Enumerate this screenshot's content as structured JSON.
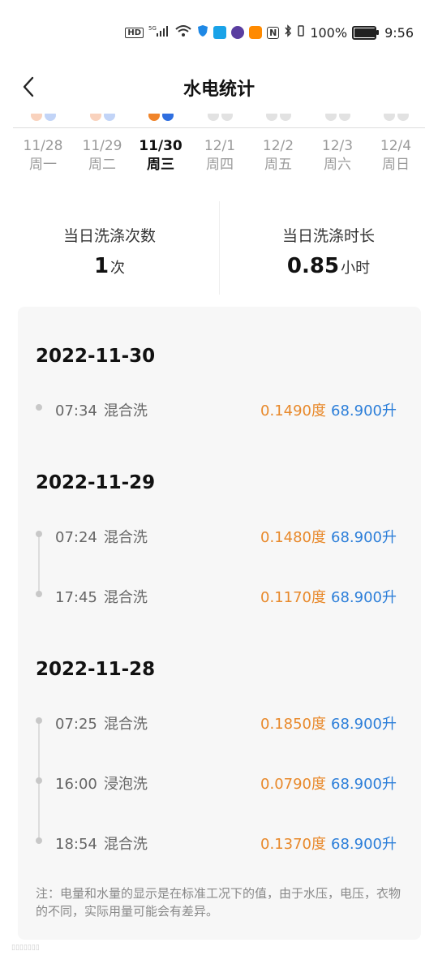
{
  "status_bar": {
    "hd": "HD",
    "net1": "5G",
    "net2": "6",
    "nfc": "N",
    "battery_label": "100%",
    "battery_level": 1.0,
    "time": "9:56"
  },
  "header": {
    "title": "水电统计",
    "back_icon": "chevron-left-icon"
  },
  "week": {
    "days": [
      {
        "date": "11/28",
        "weekday": "周一",
        "has_data": true
      },
      {
        "date": "11/29",
        "weekday": "周二",
        "has_data": true
      },
      {
        "date": "11/30",
        "weekday": "周三",
        "has_data": true,
        "selected": true
      },
      {
        "date": "12/1",
        "weekday": "周四",
        "has_data": false
      },
      {
        "date": "12/2",
        "weekday": "周五",
        "has_data": false
      },
      {
        "date": "12/3",
        "weekday": "周六",
        "has_data": false
      },
      {
        "date": "12/4",
        "weekday": "周日",
        "has_data": false
      }
    ],
    "colors": {
      "electric_light": "#f9d2bd",
      "water_light": "#c2d4f7",
      "electric_active": "#f0842a",
      "water_active": "#2f6fe0",
      "empty": "#e2e2e2"
    }
  },
  "summary": {
    "count_label": "当日洗涤次数",
    "count_value": "1",
    "count_unit": "次",
    "duration_label": "当日洗涤时长",
    "duration_value": "0.85",
    "duration_unit": "小时"
  },
  "records": [
    {
      "date": "2022-11-30",
      "items": [
        {
          "time": "07:34",
          "mode": "混合洗",
          "electricity": "0.1490度",
          "water": "68.900升"
        }
      ]
    },
    {
      "date": "2022-11-29",
      "items": [
        {
          "time": "07:24",
          "mode": "混合洗",
          "electricity": "0.1480度",
          "water": "68.900升"
        },
        {
          "time": "17:45",
          "mode": "混合洗",
          "electricity": "0.1170度",
          "water": "68.900升"
        }
      ]
    },
    {
      "date": "2022-11-28",
      "items": [
        {
          "time": "07:25",
          "mode": "混合洗",
          "electricity": "0.1850度",
          "water": "68.900升"
        },
        {
          "time": "16:00",
          "mode": "浸泡洗",
          "electricity": "0.0790度",
          "water": "68.900升"
        },
        {
          "time": "18:54",
          "mode": "混合洗",
          "electricity": "0.1370度",
          "water": "68.900升"
        }
      ]
    }
  ],
  "note": "注：电量和水量的显示是在标准工况下的值，由于水压，电压，衣物的不同，实际用量可能会有差异。",
  "colors": {
    "electricity": "#e8892b",
    "water": "#2d7fd9"
  }
}
